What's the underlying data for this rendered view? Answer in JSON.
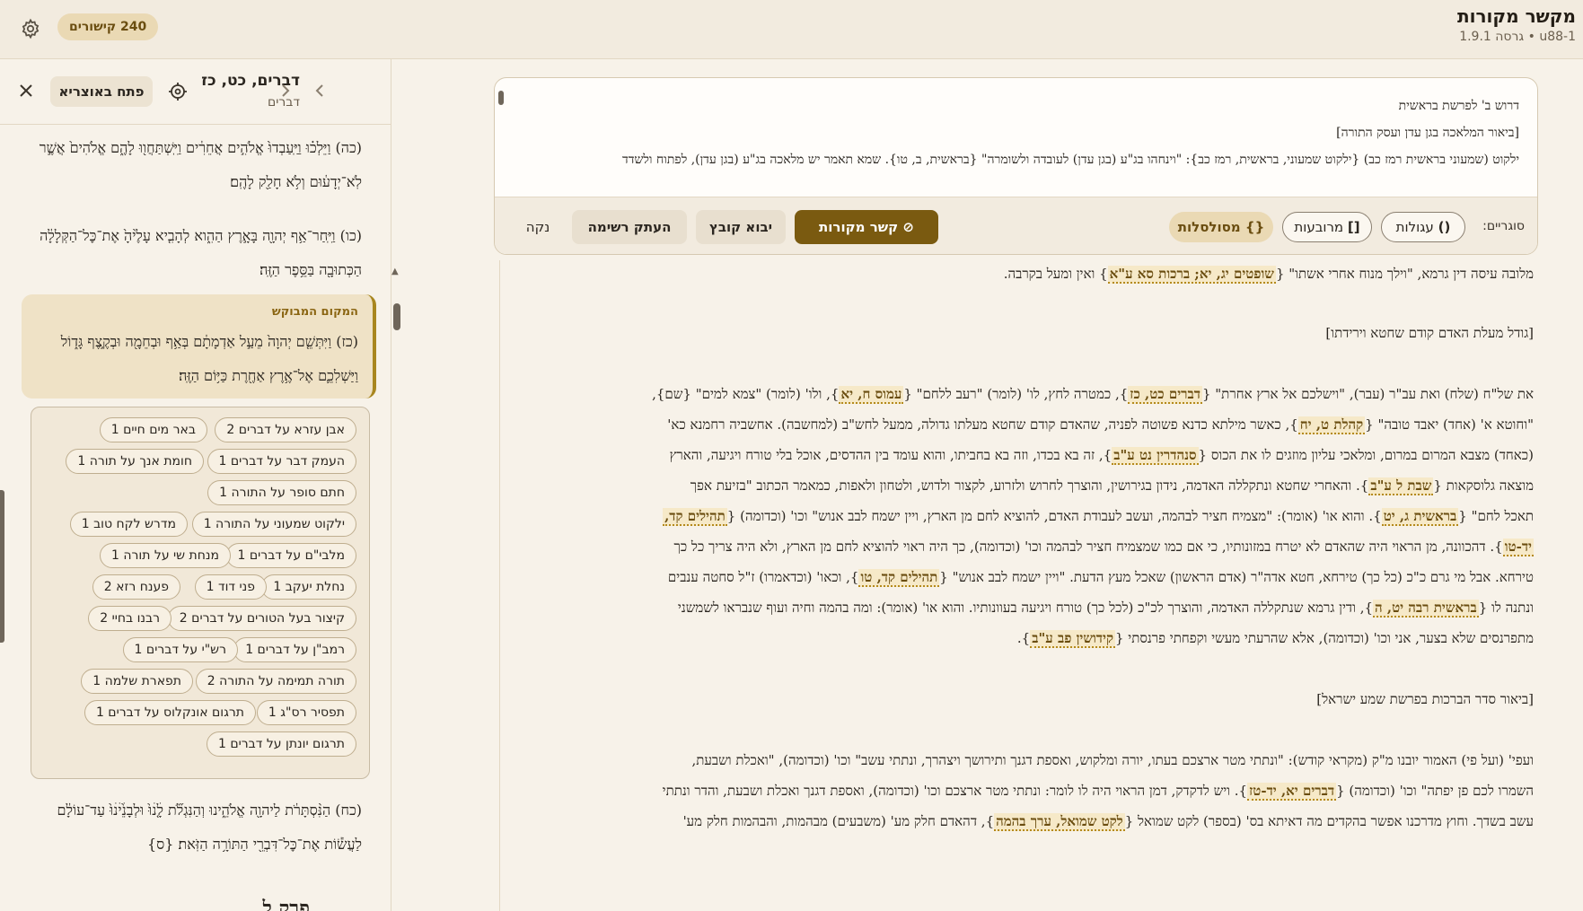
{
  "app": {
    "title": "מקשר מקורות",
    "version": "u88-1 • גרסה 1.9.1",
    "links_count": "240 קישורים"
  },
  "sidebar": {
    "title": "דברים, כט, כז",
    "subtitle": "דברים",
    "open_button": "פתח באוצריא",
    "verses": [
      "(כה) וַיֵּלְכ֗וּ וַיַּֽעַבְדוּ֙ אֱלֹהִ֣ים אֲחֵרִ֔ים וַיִּֽשְׁתַּחֲו֖וּ לָהֶ֑ם אֱלֹהִים֙ אֲשֶׁ֣ר לֹֽא־יְדָע֔וּם וְלֹ֥א חָלַ֖ק לָהֶֽם׃",
      "(כו) וַיִּֽחַר־אַ֥ף יְהוָ֖ה בָּאָ֣רֶץ הַהִ֑וא לְהָבִ֤יא עָלֶ֙יהָ֙ אֶת־כׇּל־הַקְּלָלָ֔ה הַכְּתוּבָ֖ה בַּסֵּ֥פֶר הַזֶּֽה׃"
    ],
    "sought_label": "המקום המבוקש",
    "sought_verse": "(כז) וַיִּתְּשֵׁ֤ם יְהוָה֙ מֵעַ֣ל אַדְמָתָ֔ם בְּאַ֥ף וּבְחֵמָ֖ה וּבְקֶ֣צֶף גָּד֑וֹל וַיַּשְׁלִכֵ֛ם אֶל־אֶ֥רֶץ אַחֶ֖רֶת כַּיּ֥וֹם הַזֶּֽה׃",
    "links": [
      "אבן עזרא על דברים 2",
      "באר מים חיים 1",
      "העמק דבר על דברים 1",
      "חומת אנך על תורה 1",
      "חתם סופר על התורה 1",
      "ילקוט שמעוני על התורה 1",
      "מדרש לקח טוב 1",
      "מלבי\"ם על דברים 1",
      "מנחת שי על תורה 1",
      "נחלת יעקב 1",
      "פני דוד 1",
      "פענח רזא 2",
      "קיצור בעל הטורים על דברים 2",
      "רבנו בחיי 2",
      "רמב\"ן על דברים 1",
      "רש\"י על דברים 1",
      "תורה תמימה על התורה 2",
      "תפארת שלמה 1",
      "תפסיר רס\"ג 1",
      "תרגום אונקלוס על דברים 1",
      "תרגום יונתן על דברים 1"
    ],
    "verse_28": "(כח) הַנִּ֨סְתָּרֹ֔ת לַיהוָ֖ה אֱלֹהֵ֑ינוּ וְהַנִּגְלֹ֞ת לָ֤ׄנׄוּ֙ וּלְבָנֵ֙ׄיׄנׄוּ֙ עַד־עוֹלָ֔ם לַעֲשׂ֕וֹת אֶת־כׇּל־דִּבְרֵ֖י הַתּוֹרָ֥ה הַזֹּֽאת׃ {ס}",
    "next_chapter": "פרק ל"
  },
  "editor": {
    "lines": [
      "דרוש ב' לפרשת בראשית",
      "[ביאור המלאכה בגן עדן ועסק התורה]",
      "ילקוט (שמעוני בראשית רמז כב) {ילקוט שמעוני, בראשית, רמז כב}: \"וינחהו בג\"ע (בגן עדן) לעובדה ולשומרה\" {בראשית, ב, טו}. שמא תאמר יש מלאכה בג\"ע (בגן עדן), לפתוח ולשדד"
    ]
  },
  "toolbar": {
    "brackets_label": "סוגריים:",
    "round": "עגולות",
    "square": "מרובעות",
    "curly": "מסולסלות",
    "link_sources": "קשר מקורות",
    "import_file": "יבוא קובץ",
    "copy_list": "העתק רשימה",
    "clear": "נקה"
  },
  "content": {
    "p1_a": "מלובה עיסה דין גרמא, \"וילך מנוח אחרי אשתו\" {",
    "p1_ref": "שופטים יג, יא; ברכות סא ע\"א",
    "p1_b": "} ואין ומעל בקרבה.",
    "h1": "[גודל מעלת האדם קודם שחטא וירידתו]",
    "p2_1a": "את של\"ח (שלח) ואת עב\"ר (עבר), \"וישלכם אל ארץ אחרת\" {",
    "p2_1ref": "דברים כט, כז",
    "p2_1b": "}, כמטרה לחץ, לו' (לומר) \"רעב ללחם\" {",
    "p2_1ref2": "עמוס ח, יא",
    "p2_1c": "}, ולו' (לומר) \"צמא למים\" {שם},",
    "p2_2a": "\"וחוטא א' (אחד) יאבד טובה\" {",
    "p2_2ref": "קהלת ט, יח",
    "p2_2b": "}, כאשר מילתא כדנא פשוטה לפניה, שהאדם קודם שחטא מעלתו גדולה, ממעל לחש\"ב (למחשבה). אחשביה רחמנא כא'",
    "p2_3a": "(כאחד) מצבא המרום במרום, ומלאכי עליון מוזגים לו את הכוס {",
    "p2_3ref": "סנהדרין נט ע\"ב",
    "p2_3b": "}, זה בא בכדו, וזה בא בחביתו, והוא עומד בין ההדסים, אוכל בלי טורח ויגיעה, והארץ",
    "p2_4a": "מוצאה גלוסקאות {",
    "p2_4ref": "שבת ל ע\"ב",
    "p2_4b": "}. והאחרי שחטא ונתקללה האדמה, נידון בגירושין, והוצרך לחרוש ולזרוע, לקצור ולדוש, ולטחון ולאפות, כמאמר הכתוב \"בזיעת אפך",
    "p2_5a": "תאכל לחם\" {",
    "p2_5ref": "בראשית ג, יט",
    "p2_5b": "}. והוא או' (אומר): \"מצמיח חציר לבהמה, ועשב לעבודת האדם, להוציא לחם מן הארץ, ויין ישמח לבב אנוש\" וכו' (וכדומה) {",
    "p2_5ref2": "תהילים קד,",
    "p2_6ref": "יד-טו",
    "p2_6b": "}. דהכוונה, מן הראוי היה שהאדם לא יטרח במזונותיו, כי אם כמו שמצמיח חציר לבהמה וכו' (וכדומה), כך היה ראוי להוציא לחם מן הארץ, ולא היה צריך כל כך",
    "p2_7a": "טירחא. אבל מי גרם כ\"כ (כל כך) טירחא, חטא אדה\"ר (אדם הראשון) שאכל מעץ הדעת. \"ויין ישמח לבב אנוש\" {",
    "p2_7ref": "תהילים קד, טו",
    "p2_7b": "}, וכאו' (וכדאמרו) ז\"ל סחטה ענבים",
    "p2_8a": "ונתנה לו {",
    "p2_8ref": "בראשית רבה יט, ה",
    "p2_8b": "}, ודין גרמא שנתקללה האדמה, והוצרך לכ\"כ (לכל כך) טורח ויגיעה בעוונותיו. והוא או' (אומר): ומה בהמה וחיה ועוף שנבראו לשמשני",
    "p2_9a": "מתפרנסים שלא בצער, אני וכו' (וכדומה), אלא שהרעתי מעשי וקפחתי פרנסתי {",
    "p2_9ref": "קידושין פב ע\"ב",
    "p2_9b": "}.",
    "h2": "[ביאור סדר הברכות בפרשת שמע ישראל]",
    "p3_1": "ועפי' (ועל פי) האמור יובנו מ\"ק (מקראי קודש): \"ונתתי מטר ארצכם בעתו, יורה ומלקוש, ואספת דגנך ותירושך ויצהרך, ונתתי עשב\" וכו' (וכדומה), \"ואכלת ושבעת,",
    "p3_2a": "השמרו לכם פן יפתה\" וכו' (וכדומה) {",
    "p3_2ref": "דברים יא, יד-טז",
    "p3_2b": "}. ויש לדקדק, דמן הראוי היה לו לומר: ונתתי מטר ארצכם וכו' (וכדומה), ואספת דגנך ואכלת ושבעת, והדר ונתתי",
    "p3_3a": "עשב בשדך. וחוץ מדרכנו אפשר בהקדים מה דאיתא בס' (בספר) לקט שמואל {",
    "p3_3ref": "לקט שמואל, ערך בהמה",
    "p3_3b": "}, דהאדם חלק מע' (משבעים) מבהמות, והבהמות חלק מע'"
  }
}
